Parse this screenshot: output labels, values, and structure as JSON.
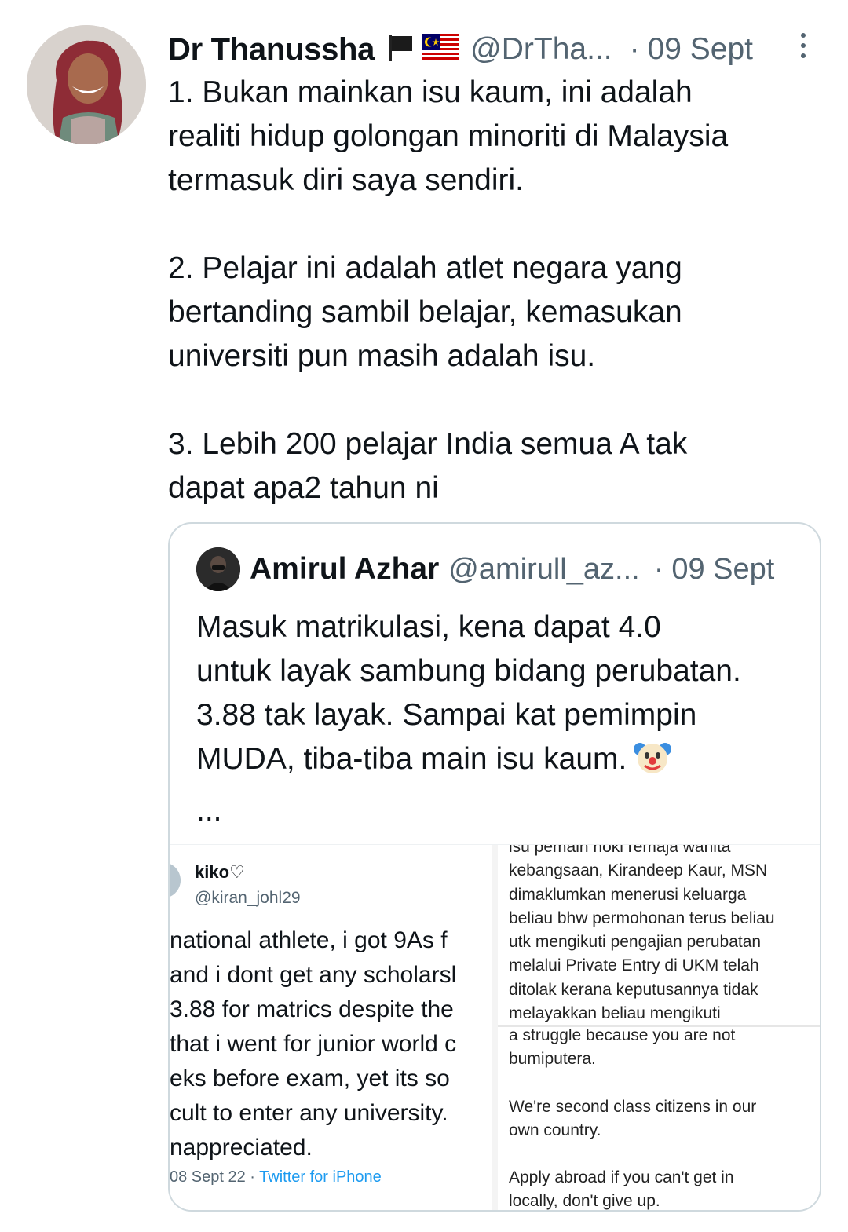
{
  "tweet": {
    "author_name": "Dr Thanussha",
    "flags": [
      "black-flag",
      "malaysia-flag"
    ],
    "handle": "@DrTha...",
    "dot": "·",
    "date": "09 Sept",
    "paragraphs": [
      [
        "1. Bukan mainkan isu kaum, ini adalah",
        "realiti hidup golongan minoriti di Malaysia",
        "termasuk diri saya sendiri."
      ],
      [
        "2. Pelajar ini adalah atlet negara yang",
        "bertanding sambil belajar, kemasukan",
        "universiti pun masih adalah isu."
      ],
      [
        "3. Lebih 200 pelajar India semua A tak",
        "dapat apa2 tahun ni"
      ]
    ]
  },
  "quote": {
    "author_name": "Amirul Azhar",
    "handle": "@amirull_az...",
    "dot": "·",
    "date": "09 Sept",
    "lines": [
      "Masuk matrikulasi, kena dapat 4.0",
      "untuk layak sambung bidang perubatan.",
      "3.88 tak layak. Sampai kat pemimpin",
      "MUDA, tiba-tiba main isu kaum."
    ],
    "emoji": "clown-face-icon",
    "more": "..."
  },
  "media": {
    "left": {
      "name": "kiko♡",
      "handle": "@kiran_johl29",
      "lines": [
        "national athlete, i got 9As f",
        "and i dont get any scholarsl",
        " 3.88 for matrics despite the",
        "that i went for junior world c",
        "eks before exam, yet its so",
        "cult to enter any university. ",
        "nappreciated."
      ],
      "date": "08 Sept 22",
      "sep": " · ",
      "source": "Twitter for iPhone"
    },
    "right_top": {
      "lines": [
        "isu pemain hoki remaja wanita",
        "kebangsaan, Kirandeep Kaur, MSN",
        "dimaklumkan menerusi keluarga",
        "beliau bhw permohonan terus beliau",
        "utk mengikuti pengajian perubatan",
        "melalui Private Entry di UKM telah",
        "ditolak kerana keputusannya tidak",
        "melayakkan beliau mengikuti"
      ]
    },
    "right_bottom": {
      "lines": [
        "a struggle because you are not",
        "bumiputera.",
        "",
        "We're second class citizens in our",
        "own country.",
        "",
        "Apply abroad if you can't get in",
        "locally, don't give up."
      ]
    }
  }
}
